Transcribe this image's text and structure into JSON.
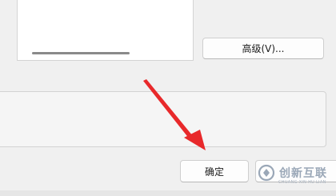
{
  "dialog": {
    "advanced_button_label": "高级(V)...",
    "ok_button_label": "确定",
    "cancel_button_label": ""
  },
  "watermark": {
    "name": "创新互联",
    "subtitle": "CHUANG XIN HU LIAN"
  },
  "colors": {
    "annotation_arrow": "#e8292b",
    "dialog_background": "#f0f0f0",
    "watermark": "#9aa7b7"
  }
}
